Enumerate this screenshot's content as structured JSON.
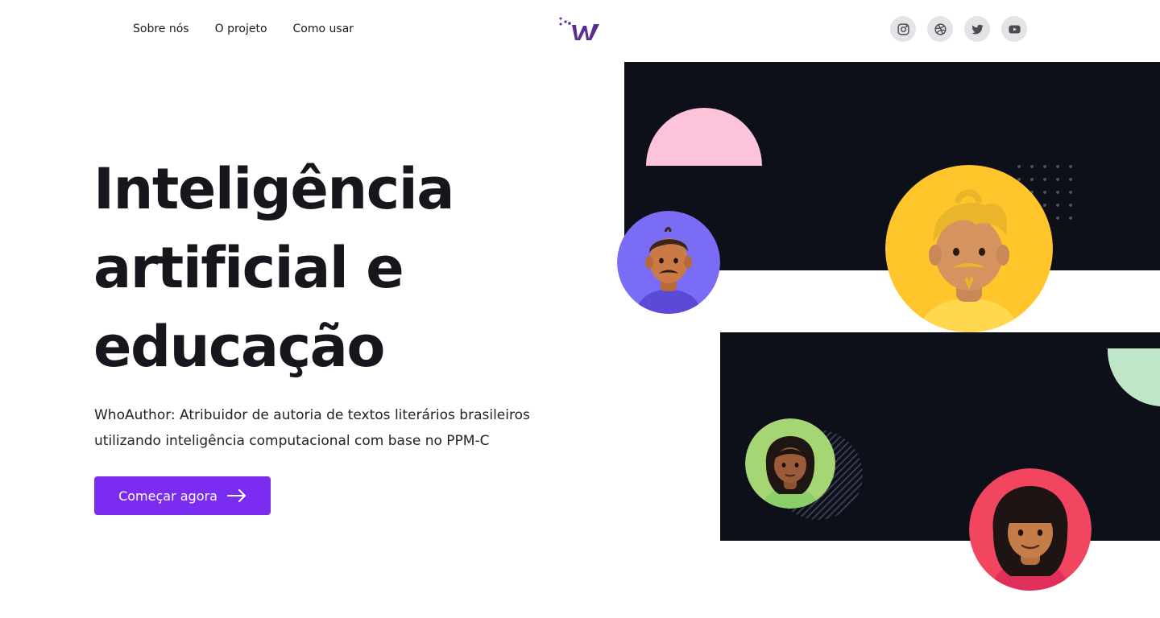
{
  "nav": {
    "links": [
      "Sobre nós",
      "O projeto",
      "Como usar"
    ]
  },
  "logo": {
    "icon": "whoauthor-logo"
  },
  "socials": [
    {
      "icon": "instagram-icon"
    },
    {
      "icon": "dribbble-icon"
    },
    {
      "icon": "twitter-icon"
    },
    {
      "icon": "youtube-icon"
    }
  ],
  "hero": {
    "title_lines": [
      "Inteligência",
      "artificial e",
      "educação"
    ],
    "subtitle": "WhoAuthor: Atribuidor de autoria de textos literários brasileiros utilizando inteligência computacional com base no PPM-C",
    "cta_label": "Começar agora"
  },
  "colors": {
    "accent": "#7a2df0",
    "panel": "#0d0f19",
    "pink": "#fcc3da",
    "mint": "#bfe6c6",
    "purple_avatar": "#7b6cf6",
    "yellow_avatar": "#ffc52a",
    "green_avatar": "#a5d673",
    "red_avatar": "#f2455f"
  }
}
